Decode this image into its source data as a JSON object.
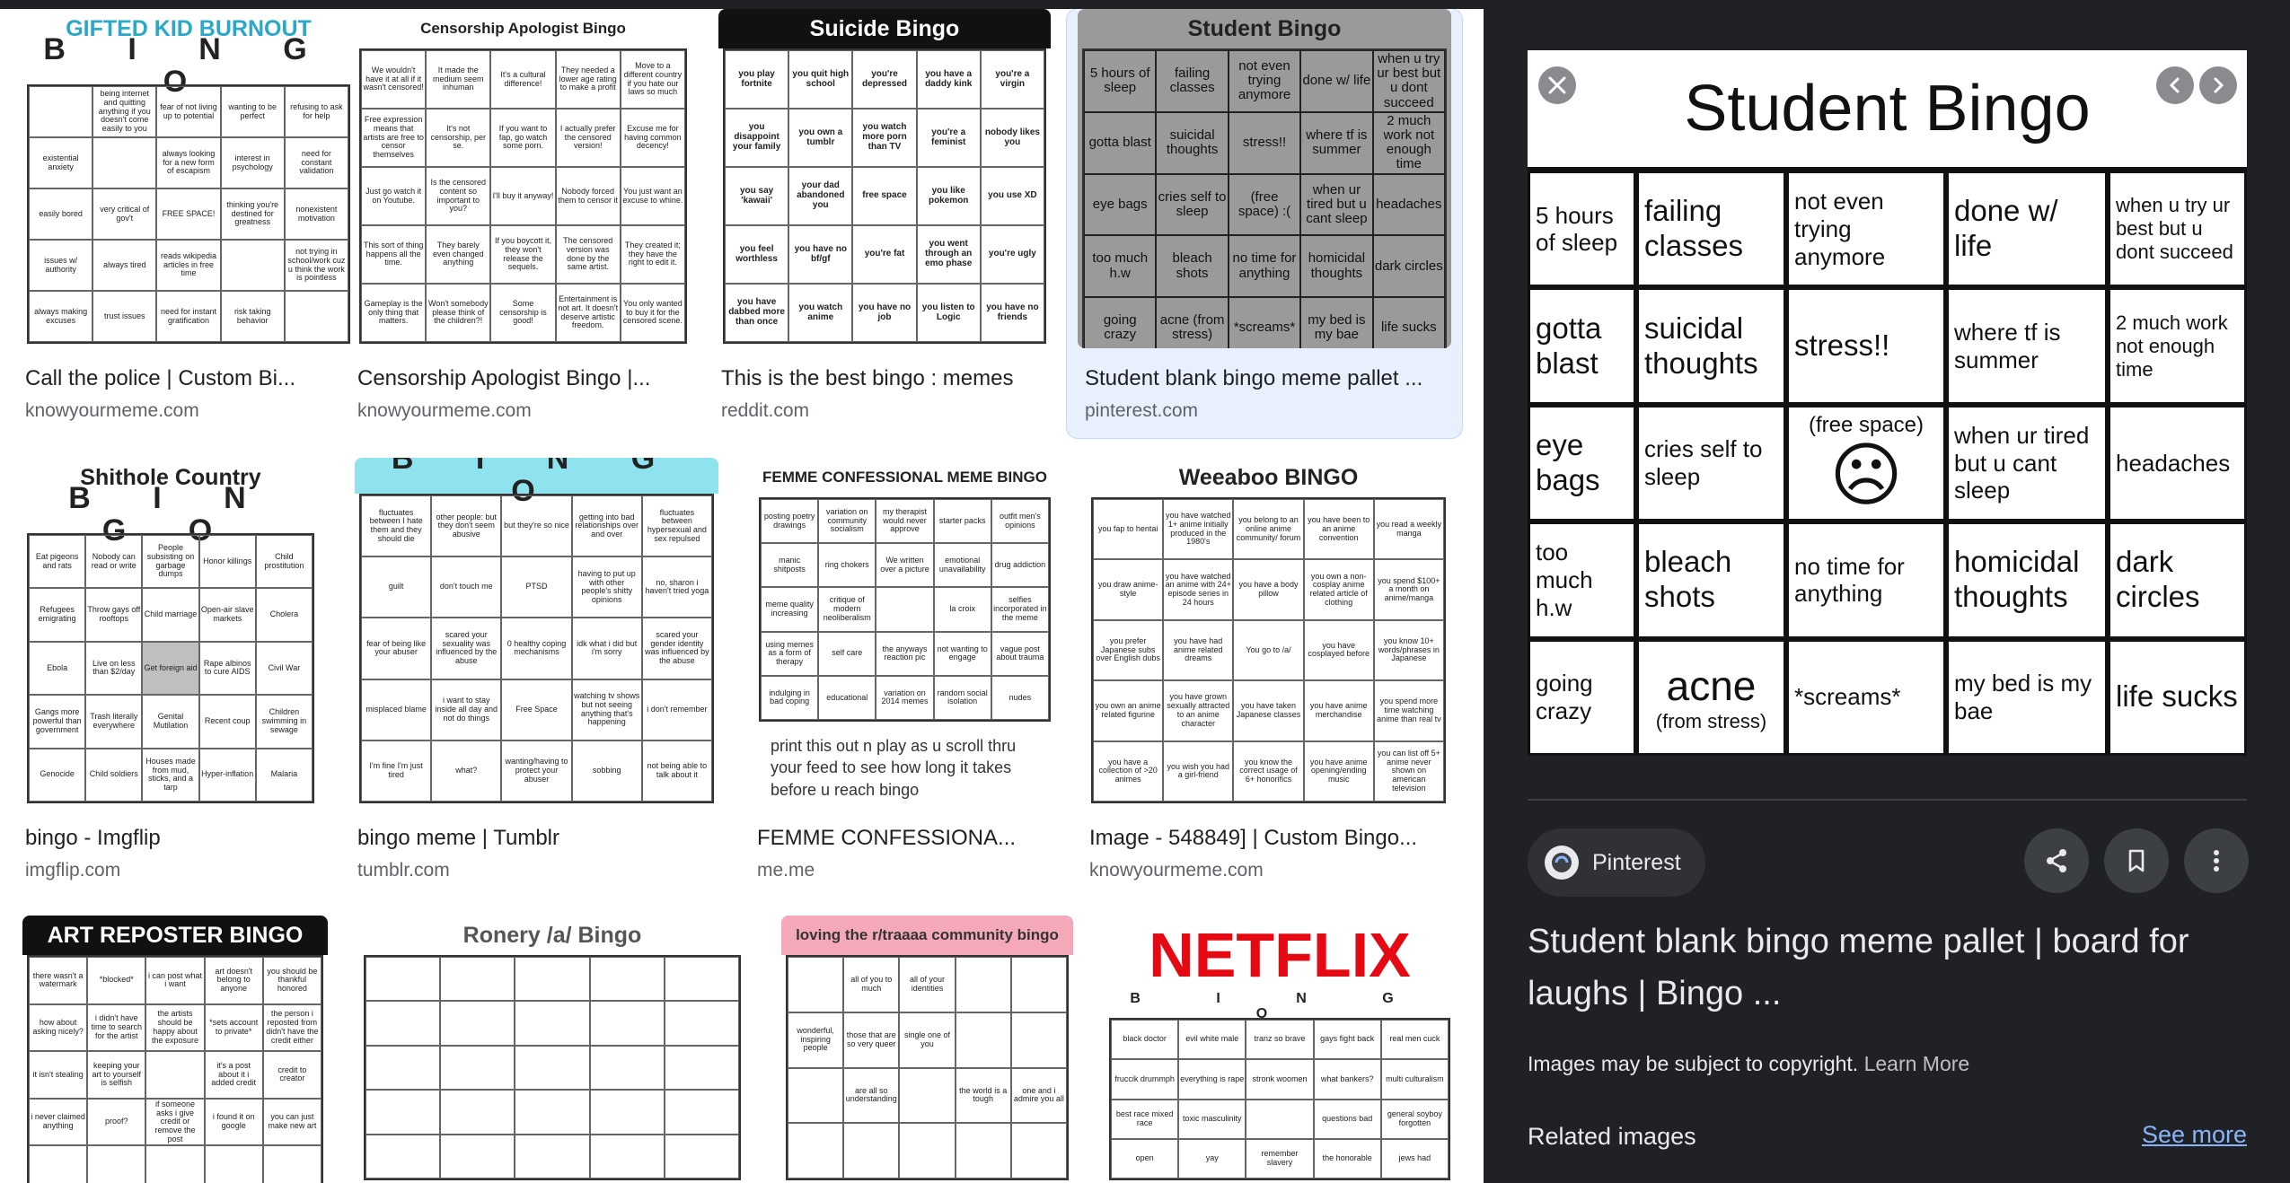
{
  "results": [
    {
      "title": "Call the police | Custom Bi...",
      "site": "knowyourmeme.com",
      "thumb": {
        "heading": "GIFTED KID BURNOUT",
        "sub": "B I N G O",
        "rows": 5,
        "cols": 5,
        "cells": [
          "",
          "being internet and quitting anything if you doesn't come easily to you",
          "fear of not living up to potential",
          "wanting to be perfect",
          "refusing to ask for help",
          "existential anxiety",
          "",
          "always looking for a new form of escapism",
          "interest in psychology",
          "need for constant validation",
          "easily bored",
          "very critical of gov't",
          "FREE SPACE!",
          "thinking you're destined for greatness",
          "nonexistent motivation",
          "issues w/ authority",
          "always tired",
          "reads wikipedia articles in free time",
          "",
          "not trying in school/work cuz u think the work is pointless",
          "always making excuses",
          "trust issues",
          "need for instant gratification",
          "risk taking behavior",
          ""
        ]
      }
    },
    {
      "title": "Censorship Apologist Bingo |...",
      "site": "knowyourmeme.com",
      "thumb": {
        "heading": "Censorship Apologist Bingo",
        "sub": "",
        "rows": 5,
        "cols": 5,
        "cells": [
          "We wouldn't have it at all if it wasn't censored!",
          "It made the medium seem inhuman",
          "It's a cultural difference!",
          "They needed a lower age rating to make a profit",
          "Move to a different country if you hate our laws so much",
          "Free expression means that artists are free to censor themselves",
          "It's not censorship, per se.",
          "If you want to fap, go watch some porn.",
          "I actually prefer the censored version!",
          "Excuse me for having common decency!",
          "Just go watch it on Youtube.",
          "Is the censored content so important to you?",
          "I'll buy it anyway!",
          "Nobody forced them to censor it",
          "You just want an excuse to whine.",
          "This sort of thing happens all the time.",
          "They barely even changed anything",
          "If you boycott it, they won't release the sequels.",
          "The censored version was done by the same artist.",
          "They created it; they have the right to edit it.",
          "Gameplay is the only thing that matters.",
          "Won't somebody please think of the children?!",
          "Some censorship is good!",
          "Entertainment is not art. It doesn't deserve artistic freedom.",
          "You only wanted to buy it for the censored scene."
        ]
      }
    },
    {
      "title": "This is the best bingo : memes",
      "site": "reddit.com",
      "thumb": {
        "heading": "Suicide Bingo",
        "sub": "",
        "rows": 5,
        "cols": 5,
        "cells": [
          "you play fortnite",
          "you quit high school",
          "you're depressed",
          "you have a daddy kink",
          "you're a virgin",
          "you disappoint your family",
          "you own a tumblr",
          "you watch more porn than TV",
          "you're a feminist",
          "nobody likes you",
          "you say 'kawaii'",
          "your dad abandoned you",
          "free space",
          "you like pokemon",
          "you use XD",
          "you feel worthless",
          "you have no bf/gf",
          "you're fat",
          "you went through an emo phase",
          "you're ugly",
          "you have dabbed more than once",
          "you watch anime",
          "you have no job",
          "you listen to Logic",
          "you have no friends"
        ]
      }
    },
    {
      "title": "Student blank bingo meme pallet ...",
      "site": "pinterest.com",
      "thumb": {
        "heading": "Student Bingo",
        "sub": "",
        "rows": 5,
        "cols": 5,
        "cells": [
          "5 hours of sleep",
          "failing classes",
          "not even trying anymore",
          "done w/ life",
          "when u try ur best but u dont succeed",
          "gotta blast",
          "suicidal thoughts",
          "stress!!",
          "where tf is summer",
          "2 much work not enough time",
          "eye bags",
          "cries self to sleep",
          "(free space) :(",
          "when ur tired but u cant sleep",
          "headaches",
          "too much h.w",
          "bleach shots",
          "no time for anything",
          "homicidal thoughts",
          "dark circles",
          "going crazy",
          "acne (from stress)",
          "*screams*",
          "my bed is my bae",
          "life sucks"
        ]
      }
    },
    {
      "title": "bingo - Imgflip",
      "site": "imgflip.com",
      "thumb": {
        "heading": "Shithole Country",
        "sub": "B I N G O",
        "rows": 5,
        "cols": 5,
        "cells": [
          "Eat pigeons and rats",
          "Nobody can read or write",
          "People subsisting on garbage dumps",
          "Honor killings",
          "Child prostitution",
          "Refugees emigrating",
          "Throw gays off rooftops",
          "Child marriage",
          "Open-air slave markets",
          "Cholera",
          "Ebola",
          "Live on less than $2/day",
          "Get foreign aid",
          "Rape albinos to cure AIDS",
          "Civil War",
          "Gangs more powerful than government",
          "Trash literally everywhere",
          "Genital Mutilation",
          "Recent coup",
          "Children swimming in sewage",
          "Genocide",
          "Child soldiers",
          "Houses made from mud, sticks, and a tarp",
          "Hyper-inflation",
          "Malaria"
        ]
      }
    },
    {
      "title": "bingo meme | Tumblr",
      "site": "tumblr.com",
      "thumb": {
        "heading": "",
        "sub": "B I N G O",
        "rows": 5,
        "cols": 5,
        "cells": [
          "fluctuates between I hate them and they should die",
          "other people: but they don't seem abusive",
          "but they're so nice",
          "getting into bad relationships over and over",
          "fluctuates between hypersexual and sex repulsed",
          "guilt",
          "don't touch me",
          "PTSD",
          "having to put up with other people's shitty opinions",
          "no, sharon i haven't tried yoga",
          "fear of being like your abuser",
          "scared your sexuality was influenced by the abuse",
          "0 healthy coping mechanisms",
          "idk what i did but i'm sorry",
          "scared your gender identity was influenced by the abuse",
          "misplaced blame",
          "i want to stay inside all day and not do things",
          "Free Space",
          "watching tv shows but not seeing anything that's happening",
          "i don't remember",
          "I'm fine I'm just tired",
          "what?",
          "wanting/having to protect your abuser",
          "sobbing",
          "not being able to talk about it"
        ]
      }
    },
    {
      "title": "FEMME CONFESSIONA...",
      "site": "me.me",
      "thumb": {
        "heading": "FEMME CONFESSIONAL MEME BINGO",
        "sub": "",
        "rows": 5,
        "cols": 5,
        "cells": [
          "posting poetry drawings",
          "variation on community socialism",
          "my therapist would never approve",
          "starter packs",
          "outfit men's opinions",
          "manic shitposts",
          "ring chokers",
          "We written over a picture",
          "emotional unavailability",
          "drug addiction",
          "meme quality increasing",
          "critique of modern neoliberalism",
          "",
          "la croix",
          "selfies incorporated in the meme",
          "using memes as a form of therapy",
          "self care",
          "the anyways reaction pic",
          "not wanting to engage",
          "vague post about trauma",
          "indulging in bad coping",
          "educational",
          "variation on 2014 memes",
          "random social isolation",
          "nudes"
        ],
        "note": "print this out n play as u scroll thru your feed to see how long it takes before u reach bingo"
      }
    },
    {
      "title": "Image - 548849] | Custom Bingo...",
      "site": "knowyourmeme.com",
      "thumb": {
        "heading": "Weeaboo BINGO",
        "sub": "",
        "rows": 5,
        "cols": 5,
        "cells": [
          "you fap to hentai",
          "you have watched 1+ anime initially produced in the 1980's",
          "you belong to an online anime community/ forum",
          "you have been to an anime convention",
          "you read a weekly manga",
          "you draw anime-style",
          "you have watched an anime with 24+ episode series in 24 hours",
          "you have a body pillow",
          "you own a non-cosplay anime related article of clothing",
          "you spend $100+ a month on anime/manga",
          "you prefer Japanese subs over English dubs",
          "you have had anime related dreams",
          "You go to /a/",
          "you have cosplayed before",
          "you know 10+ words/phrases in Japanese",
          "you own an anime related figurine",
          "you have grown sexually attracted to an anime character",
          "you have taken Japanese classes",
          "you have anime merchandise",
          "you spend more time watching anime than real tv",
          "you have a collection of >20 animes",
          "you wish you had a girl-friend",
          "you know the correct usage of 6+ honorifics",
          "you have anime opening/ending music",
          "you can list off 5+ anime never shown on american television"
        ]
      }
    },
    {
      "title": "",
      "site": "",
      "thumb": {
        "heading": "ART REPOSTER BINGO",
        "sub": "",
        "rows": 5,
        "cols": 5,
        "cells": [
          "there wasn't a watermark",
          "*blocked*",
          "i can post what i want",
          "art doesn't belong to anyone",
          "you should be thankful honored",
          "how about asking nicely?",
          "i didn't have time to search for the artist",
          "the artists should be happy about the exposure",
          "*sets account to private*",
          "the person i reposted from didn't have the credit either",
          "it isn't stealing",
          "keeping your art to yourself is selfish",
          "",
          "it's a post about it i added credit",
          "credit to creator",
          "i never claimed anything",
          "proof?",
          "if someone asks i give credit or remove the post",
          "i found it on google",
          "you can just make new art",
          "",
          "",
          "",
          "",
          ""
        ]
      }
    },
    {
      "title": "",
      "site": "",
      "thumb": {
        "heading": "Ronery /a/ Bingo",
        "sub": "",
        "rows": 5,
        "cols": 5,
        "cells": [
          "",
          "",
          "",
          "",
          "",
          "",
          "",
          "",
          "",
          "",
          "",
          "",
          "",
          "",
          "",
          "",
          "",
          "",
          "",
          "",
          "",
          "",
          "",
          "",
          ""
        ]
      }
    },
    {
      "title": "",
      "site": "",
      "thumb": {
        "heading": "loving the r/traaaa community bingo",
        "sub": "",
        "rows": 5,
        "cols": 5,
        "cells": [
          "",
          "all of you to much",
          "all of your identities",
          "",
          "",
          "wonderful, inspiring people",
          "those that are so very queer",
          "single one of you",
          "",
          "",
          "",
          "are all so understanding",
          "",
          "the world is a tough",
          "one and i admire you all",
          "",
          "",
          "",
          "",
          ""
        ]
      }
    },
    {
      "title": "",
      "site": "",
      "thumb": {
        "heading": "NETFLIX",
        "sub": "B I N G O",
        "rows": 5,
        "cols": 5,
        "cells": [
          "black doctor",
          "evil white male",
          "tranz so brave",
          "gays fight back",
          "real men cuck",
          "fruccik drummph",
          "everything is rape",
          "stronk woomen",
          "what bankers?",
          "multi culturalism",
          "best race mixed race",
          "toxic masculinity",
          "",
          "questions bad",
          "general soyboy forgotten",
          "open",
          "yay",
          "remember slavery",
          "the honorable",
          "jews had"
        ]
      }
    }
  ],
  "panel": {
    "big": {
      "title": "Student Bingo",
      "cells": [
        [
          "5 hours of sleep",
          "failing classes",
          "not even trying anymore",
          "done w/ life",
          "when u try ur best but u dont succeed"
        ],
        [
          "gotta blast",
          "suicidal thoughts",
          "stress!!",
          "where tf is summer",
          "2 much work not enough time"
        ],
        [
          "eye bags",
          "cries self to sleep",
          "(free space)",
          "when ur tired but u cant sleep",
          "headaches"
        ],
        [
          "too much h.w",
          "bleach shots",
          "no time for anything",
          "homicidal thoughts",
          "dark circles"
        ],
        [
          "going crazy",
          "acne",
          "*screams*",
          "my bed is my bae",
          "life sucks"
        ]
      ],
      "acne_note": "(from stress)",
      "free_face": "☹"
    },
    "source": "Pinterest",
    "title": "Student blank bingo meme pallet | board for laughs | Bingo ...",
    "copyright": "Images may be subject to copyright.",
    "learn_more": "Learn More",
    "related": "Related images",
    "see_more": "See more",
    "icons": [
      "close-icon",
      "chevron-left-icon",
      "chevron-right-icon",
      "share-icon",
      "bookmark-icon",
      "more-vert-icon",
      "pinterest-icon"
    ]
  },
  "colors": {
    "panel_bg": "#202124",
    "selected_bg": "#e8f0fe",
    "link": "#8ab4f8",
    "site_text": "#5f6368"
  }
}
